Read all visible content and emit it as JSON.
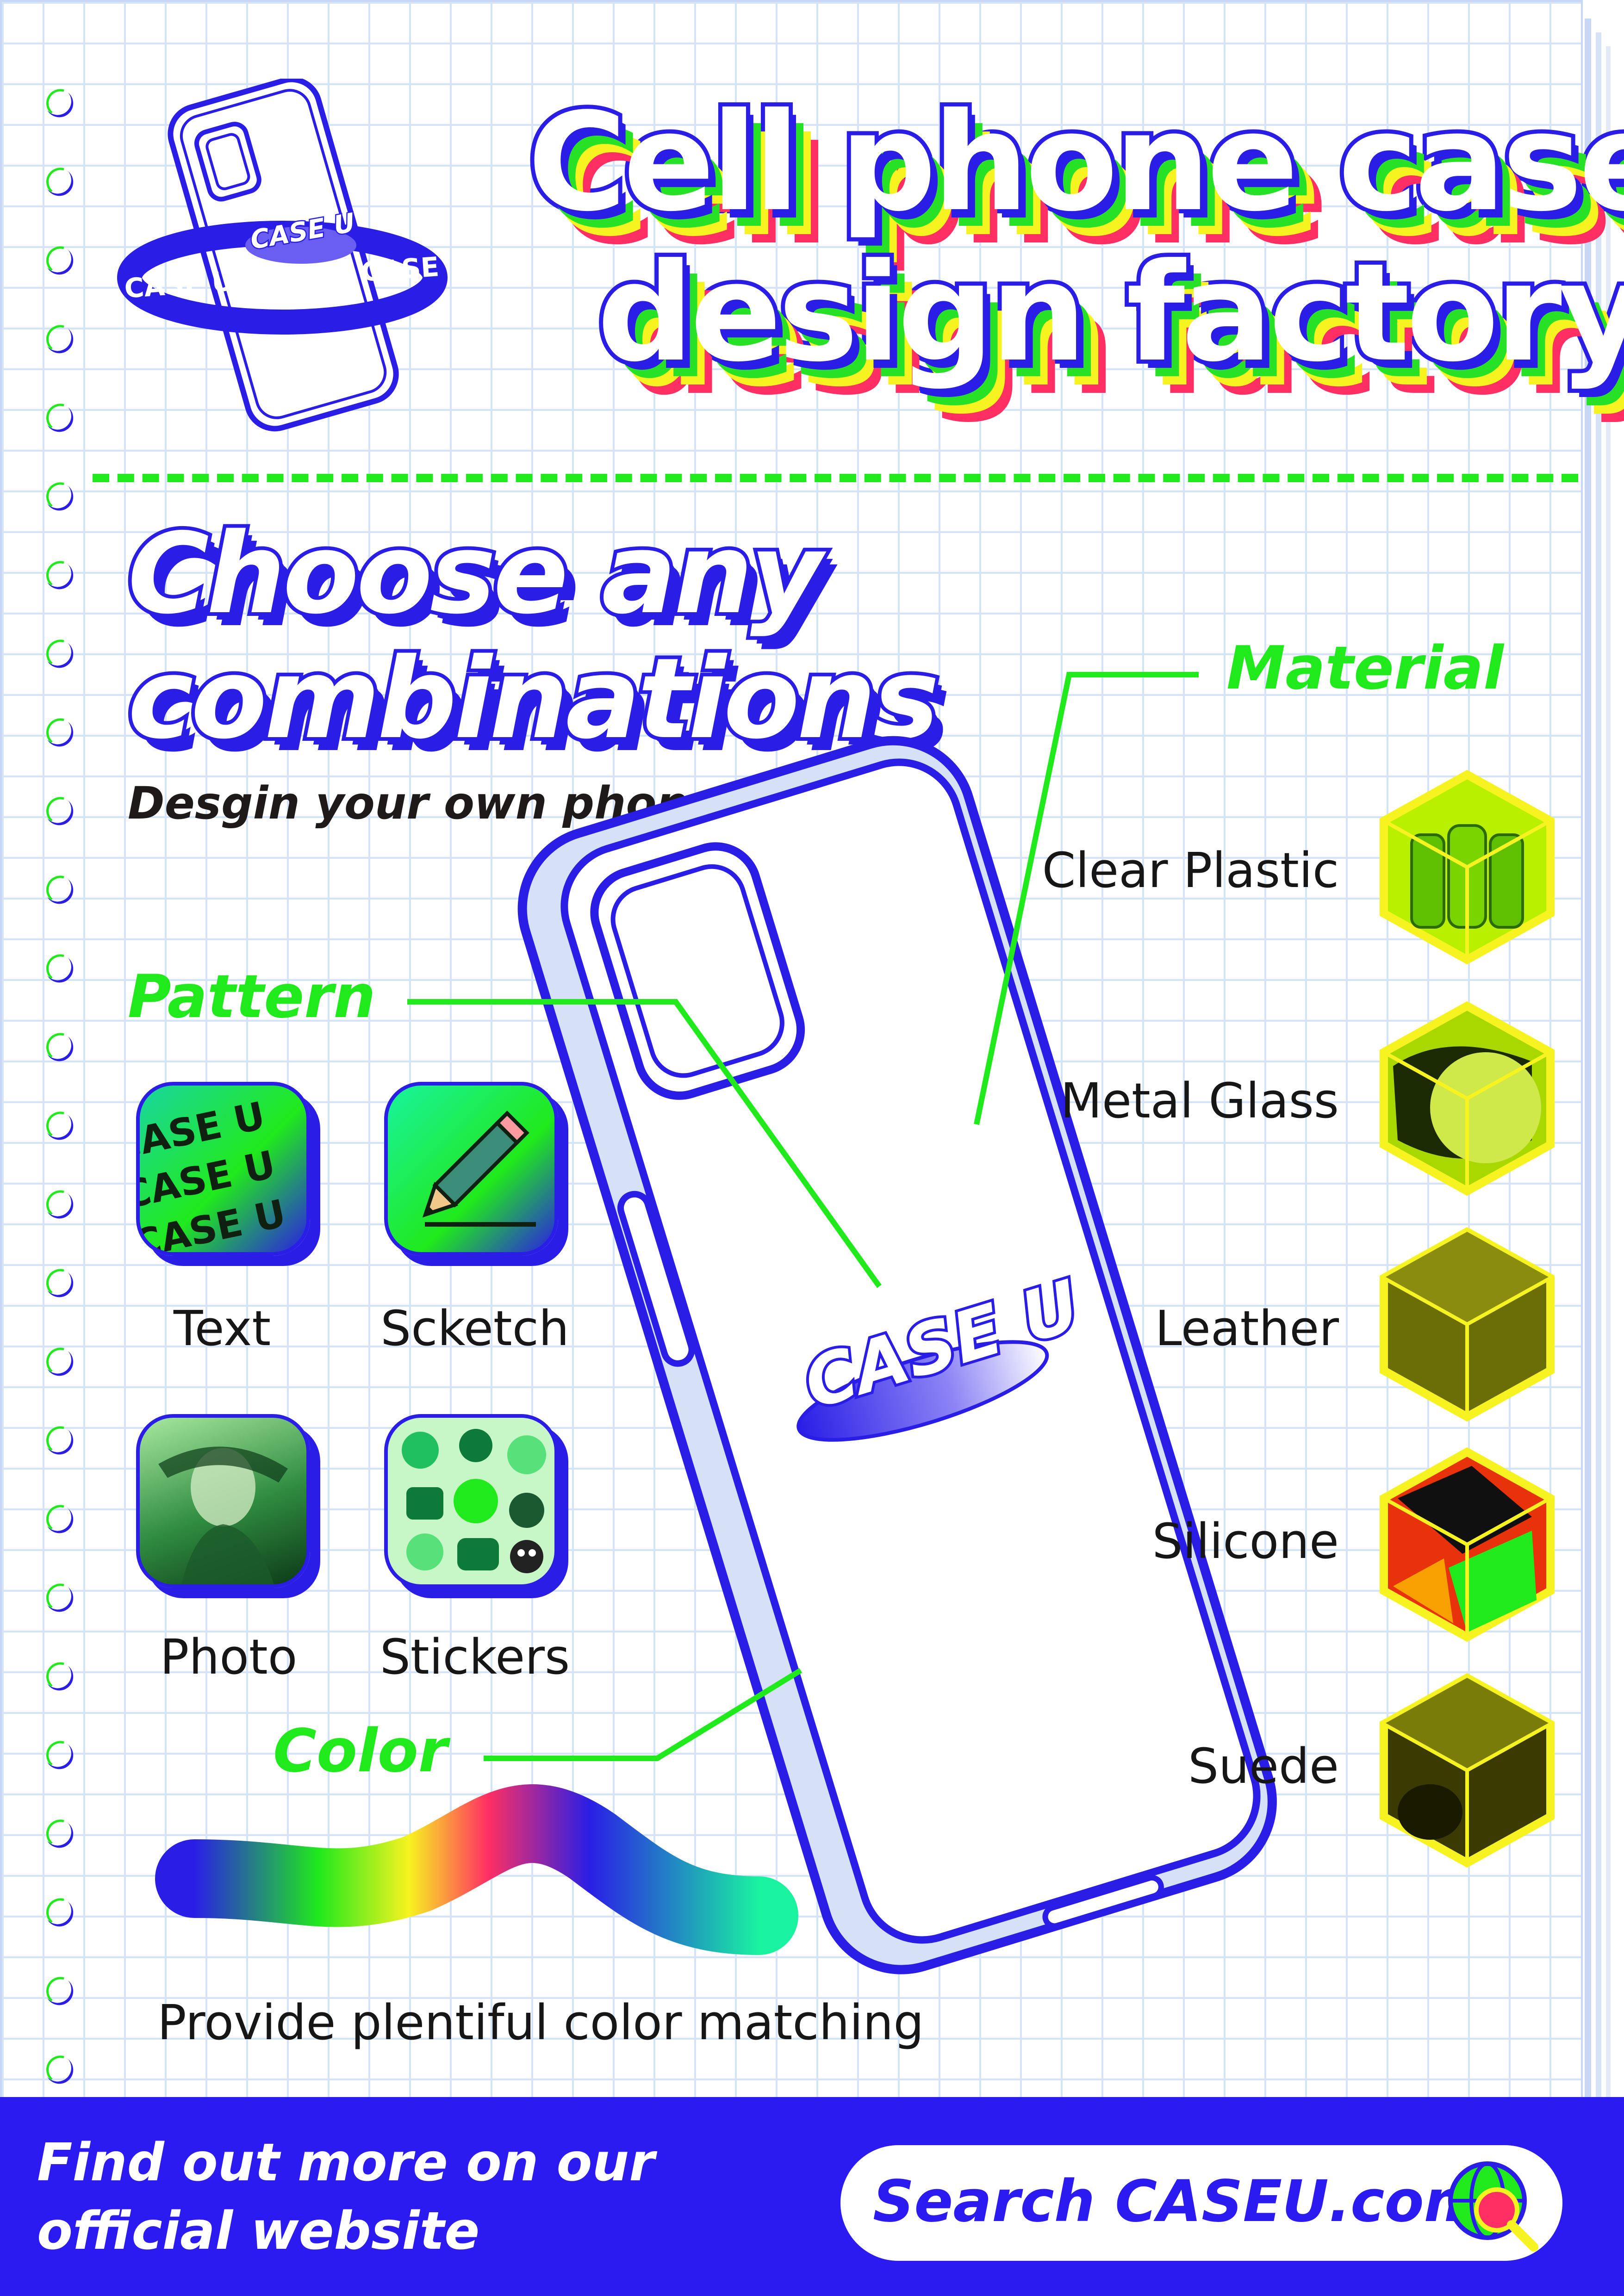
{
  "header": {
    "title_line1": "Cell phone case",
    "title_line2": "design factory"
  },
  "brand": {
    "logo_text": "CASE U",
    "ring_text": "CASE U CASE U CASE U CASE U"
  },
  "intro": {
    "headline_line1": "Choose any",
    "headline_line2": "combinations",
    "tagline": "Desgin your own phone case now"
  },
  "pattern": {
    "label": "Pattern",
    "options": [
      {
        "label": "Text",
        "icon": "text-pattern-icon"
      },
      {
        "label": "Scketch",
        "icon": "pencil-icon"
      },
      {
        "label": "Photo",
        "icon": "photo-icon"
      },
      {
        "label": "Stickers",
        "icon": "stickers-icon"
      }
    ],
    "text_tile_word": "CASE U"
  },
  "material": {
    "label": "Material",
    "options": [
      {
        "label": "Clear Plastic"
      },
      {
        "label": "Metal Glass"
      },
      {
        "label": "Leather"
      },
      {
        "label": "Silicone"
      },
      {
        "label": "Suede"
      }
    ]
  },
  "color": {
    "label": "Color",
    "caption": "Provide plentiful color matching"
  },
  "footer": {
    "text_line1": "Find out more on our",
    "text_line2": "official website",
    "search_text": "Search CASEU.com",
    "search_icon": "globe-search-icon"
  },
  "colors": {
    "brand_blue": "#2a1ee6",
    "accent_green": "#20e91c",
    "yellow": "#f7f320",
    "pink": "#ff2f63"
  }
}
